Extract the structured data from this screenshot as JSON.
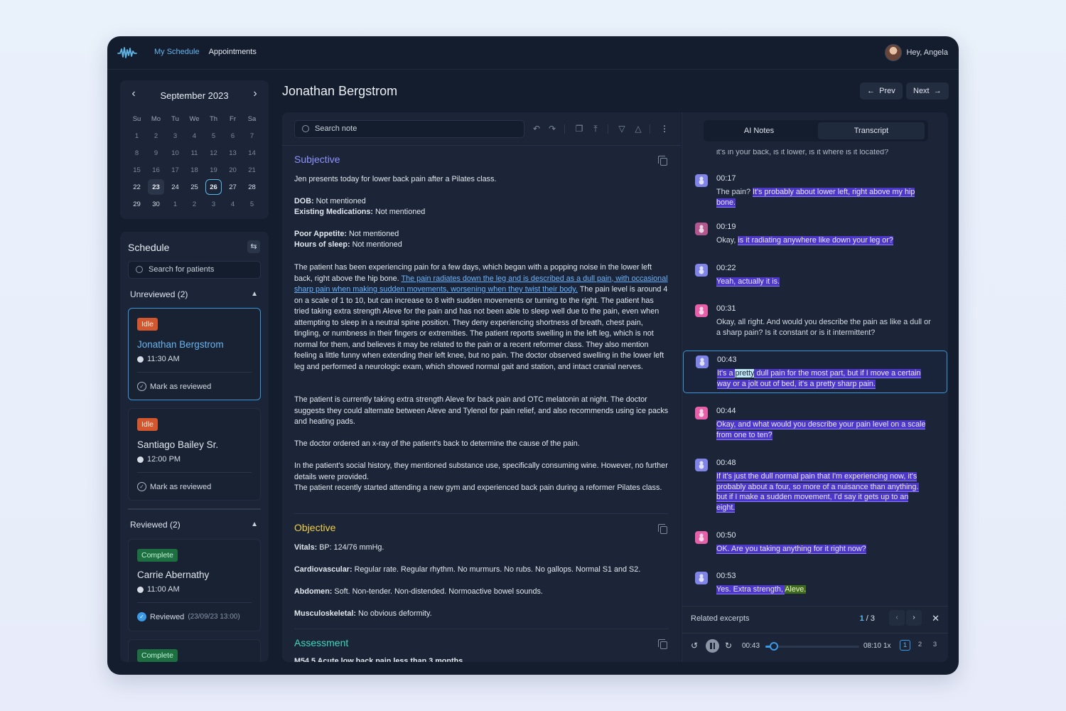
{
  "nav": {
    "my_schedule": "My Schedule",
    "appointments": "Appointments"
  },
  "user": {
    "greeting": "Hey, Angela"
  },
  "calendar": {
    "month": "September 2023",
    "weekdays": [
      "Su",
      "Mo",
      "Tu",
      "We",
      "Th",
      "Fr",
      "Sa"
    ],
    "weeks": [
      [
        "1",
        "2",
        "3",
        "4",
        "5",
        "6",
        "7"
      ],
      [
        "8",
        "9",
        "10",
        "11",
        "12",
        "13",
        "14"
      ],
      [
        "15",
        "16",
        "17",
        "18",
        "19",
        "20",
        "21"
      ],
      [
        "22",
        "23",
        "24",
        "25",
        "26",
        "27",
        "28"
      ],
      [
        "29",
        "30",
        "1",
        "2",
        "3",
        "4",
        "5"
      ]
    ],
    "today": "23",
    "selected": "26"
  },
  "schedule": {
    "title": "Schedule",
    "search_placeholder": "Search for patients",
    "unreviewed_label": "Unreviewed (2)",
    "reviewed_label": "Reviewed (2)",
    "unreviewed": [
      {
        "status": "Idle",
        "name": "Jonathan Bergstrom",
        "time": "11:30 AM",
        "action": "Mark as reviewed"
      },
      {
        "status": "Idle",
        "name": "Santiago Bailey Sr.",
        "time": "12:00 PM",
        "action": "Mark as reviewed"
      }
    ],
    "reviewed": [
      {
        "status": "Complete",
        "name": "Carrie Abernathy",
        "time": "11:00 AM",
        "action": "Reviewed",
        "action_date": "(23/09/23 13:00)"
      },
      {
        "status": "Complete"
      }
    ]
  },
  "patient": {
    "name": "Jonathan Bergstrom",
    "prev": "Prev",
    "next": "Next"
  },
  "note": {
    "search_placeholder": "Search note",
    "subjective": {
      "title": "Subjective",
      "intro": "Jen presents today for lower back pain after a Pilates class.",
      "dob_label": "DOB:",
      "dob_value": " Not mentioned",
      "meds_label": "Existing Medications:",
      "meds_value": " Not mentioned",
      "appetite_label": "Poor Appetite:",
      "appetite_value": " Not mentioned",
      "sleep_label": "Hours of sleep:",
      "sleep_value": " Not mentioned",
      "hpi_1": "The patient has been experiencing pain for a few days, which began with a popping noise in the lower left back, right above the hip bone. ",
      "hpi_link": "The pain radiates down the leg and is described as a dull pain, with occasional sharp pain when making sudden movements, worsening when they twist their body.",
      "hpi_2": " The pain level is around 4 on a scale of 1 to 10, but can increase to 8 with sudden movements or turning to the right. The patient has tried taking extra strength Aleve for the pain and has not been able to sleep well due to the pain, even when attempting to sleep in a neutral spine position. They deny experiencing shortness of breath, chest pain, tingling, or numbness in their fingers or extremities. The patient reports swelling in the left leg, which is not normal for them, and believes it may be related to the pain or a recent reformer class. They also mention feeling a little funny when extending their left knee, but no pain. The doctor observed swelling in the lower left leg and performed a neurologic exam, which showed normal gait and station, and intact cranial nerves.",
      "meds_para": "The patient is currently taking extra strength Aleve for back pain and OTC melatonin at night. The doctor suggests they could alternate between Aleve and Tylenol for pain relief, and also recommends using ice packs and heating pads.",
      "xray_para": "The doctor ordered an x-ray of the patient's back to determine the cause of the pain.",
      "social_para": "In the patient's social history, they mentioned substance use, specifically consuming wine. However, no further details were provided.",
      "gym_para": "The patient recently started attending a new gym and experienced back pain during a reformer Pilates class."
    },
    "objective": {
      "title": "Objective",
      "vitals_label": "Vitals:",
      "vitals_value": " BP: 124/76 mmHg.",
      "cardio_label": "Cardiovascular:",
      "cardio_value": " Regular rate. Regular rhythm. No murmurs. No rubs. No gallops. Normal S1 and S2.",
      "abdomen_label": "Abdomen:",
      "abdomen_value": " Soft. Non-tender. Non-distended. Normoactive bowel sounds.",
      "msk_label": "Musculoskeletal:",
      "msk_value": " No  obvious deformity."
    },
    "assessment": {
      "title": "Assessment",
      "first_line": "M54.5 Acute low back pain less than 3 months"
    }
  },
  "transcript": {
    "tab_ai": "AI Notes",
    "tab_transcript": "Transcript",
    "cut_line": "it's in your back, is it lower, is it where is it located?",
    "messages": [
      {
        "time": "00:17",
        "pre": "The pain? ",
        "mark": "It's probably about lower left, right above my hip bone."
      },
      {
        "time": "00:19",
        "pre": "Okay, ",
        "mark": "is it radiating anywhere like down your leg or?"
      },
      {
        "time": "00:22",
        "pre": "",
        "mark": "Yeah, actually it is."
      },
      {
        "time": "00:31",
        "pre": "Okay, all right. And would you describe the pain as like a dull or a sharp pain? Is it constant or is it intermittent?",
        "mark": ""
      },
      {
        "time": "00:43",
        "mark_a": "It's a ",
        "word": "pretty",
        "mark_b": " dull pain for the most part, but if I move a certain way or a jolt out of bed, it's a pretty sharp pain."
      },
      {
        "time": "00:44",
        "pre": "",
        "mark": "Okay, and what would you describe your pain level on a scale from one to ten?"
      },
      {
        "time": "00:48",
        "pre": "",
        "mark": "If it's just the dull normal pain that I'm experiencing now, it's probably about a four, so more of a nuisance than anything. but if I make a sudden movement, I'd say it gets up to an eight."
      },
      {
        "time": "00:50",
        "pre": "",
        "mark": "OK. Are you taking anything for it right now?"
      },
      {
        "time": "00:53",
        "mark_a": "Yes. Extra strength, ",
        "word": "Aleve."
      }
    ],
    "related_label": "Related excerpts",
    "related_index": "1",
    "related_total": " / 3",
    "player": {
      "current": "00:43",
      "duration": "08:10",
      "speed": "1x",
      "progress": 0.088,
      "pages": [
        "1",
        "2",
        "3"
      ]
    }
  }
}
